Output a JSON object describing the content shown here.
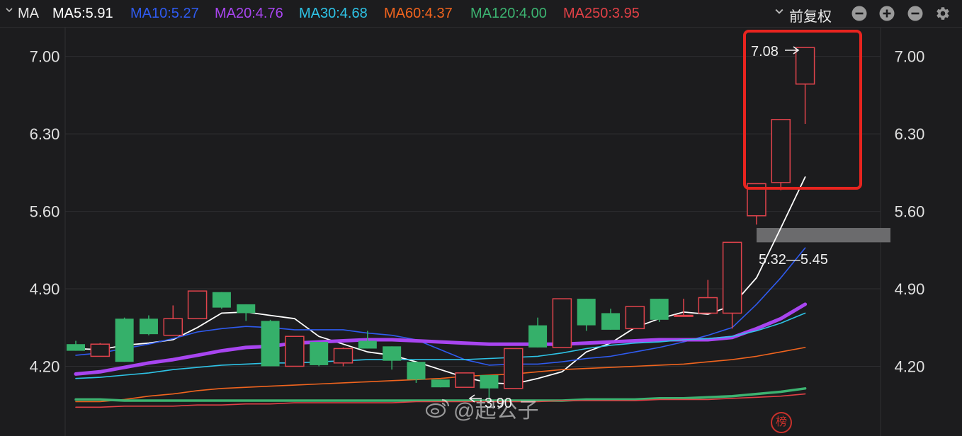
{
  "toolbar": {
    "title": "MA",
    "indicators": [
      {
        "label": "MA5:5.91",
        "color": "#ffffff"
      },
      {
        "label": "MA10:5.27",
        "color": "#2f5bf0"
      },
      {
        "label": "MA20:4.76",
        "color": "#a845f0"
      },
      {
        "label": "MA30:4.68",
        "color": "#2ec3e6"
      },
      {
        "label": "MA60:4.37",
        "color": "#f0641e"
      },
      {
        "label": "MA120:4.00",
        "color": "#3cb371"
      },
      {
        "label": "MA250:3.95",
        "color": "#e04046"
      }
    ],
    "adjust_label": "前复权",
    "icons": [
      "minus-circle-icon",
      "plus-circle-icon",
      "minus-circle-icon",
      "gear-icon"
    ]
  },
  "chart_data": {
    "type": "candlestick",
    "y_ticks": [
      "7.00",
      "6.30",
      "5.60",
      "4.90",
      "4.20"
    ],
    "ylim": [
      3.57,
      7.26
    ],
    "grid": true,
    "candles": [
      {
        "o": 4.4,
        "h": 4.43,
        "c": 4.34,
        "l": 4.34
      },
      {
        "o": 4.29,
        "h": 4.41,
        "c": 4.4,
        "l": 4.29
      },
      {
        "o": 4.63,
        "h": 4.64,
        "c": 4.24,
        "l": 4.24
      },
      {
        "o": 4.63,
        "h": 4.66,
        "c": 4.49,
        "l": 4.48
      },
      {
        "o": 4.48,
        "h": 4.75,
        "c": 4.63,
        "l": 4.48
      },
      {
        "o": 4.63,
        "h": 4.88,
        "c": 4.88,
        "l": 4.63
      },
      {
        "o": 4.87,
        "h": 4.87,
        "c": 4.73,
        "l": 4.72
      },
      {
        "o": 4.76,
        "h": 4.76,
        "c": 4.68,
        "l": 4.61
      },
      {
        "o": 4.61,
        "h": 4.62,
        "c": 4.2,
        "l": 4.2
      },
      {
        "o": 4.2,
        "h": 4.47,
        "c": 4.47,
        "l": 4.2
      },
      {
        "o": 4.42,
        "h": 4.42,
        "c": 4.21,
        "l": 4.2
      },
      {
        "o": 4.23,
        "h": 4.37,
        "c": 4.36,
        "l": 4.2
      },
      {
        "o": 4.43,
        "h": 4.52,
        "c": 4.36,
        "l": 4.36
      },
      {
        "o": 4.38,
        "h": 4.38,
        "c": 4.25,
        "l": 4.17
      },
      {
        "o": 4.24,
        "h": 4.24,
        "c": 4.08,
        "l": 4.05
      },
      {
        "o": 4.08,
        "h": 4.08,
        "c": 4.01,
        "l": 4.01
      },
      {
        "o": 4.01,
        "h": 4.14,
        "c": 4.14,
        "l": 4.01
      },
      {
        "o": 4.12,
        "h": 4.12,
        "c": 4.0,
        "l": 3.9
      },
      {
        "o": 4.0,
        "h": 4.36,
        "c": 4.36,
        "l": 4.0
      },
      {
        "o": 4.57,
        "h": 4.64,
        "c": 4.37,
        "l": 4.37
      },
      {
        "o": 4.37,
        "h": 4.81,
        "c": 4.81,
        "l": 4.37
      },
      {
        "o": 4.81,
        "h": 4.81,
        "c": 4.57,
        "l": 4.52
      },
      {
        "o": 4.68,
        "h": 4.72,
        "c": 4.53,
        "l": 4.53
      },
      {
        "o": 4.54,
        "h": 4.74,
        "c": 4.74,
        "l": 4.54
      },
      {
        "o": 4.81,
        "h": 4.81,
        "c": 4.62,
        "l": 4.6
      },
      {
        "o": 4.66,
        "h": 4.81,
        "c": 4.66,
        "l": 4.66
      },
      {
        "o": 4.68,
        "h": 4.98,
        "c": 4.82,
        "l": 4.68
      },
      {
        "o": 4.68,
        "h": 5.32,
        "c": 5.32,
        "l": 4.54
      },
      {
        "o": 5.56,
        "h": 5.85,
        "c": 5.85,
        "l": 5.48
      },
      {
        "o": 5.86,
        "h": 6.43,
        "c": 6.43,
        "l": 5.79
      },
      {
        "o": 6.75,
        "h": 7.08,
        "c": 7.08,
        "l": 6.39
      }
    ],
    "moving_averages": [
      {
        "name": "MA5",
        "color": "#ffffff",
        "width": 1.8,
        "values": [
          4.36,
          4.35,
          4.39,
          4.41,
          4.44,
          4.55,
          4.68,
          4.69,
          4.66,
          4.63,
          4.47,
          4.4,
          4.33,
          4.3,
          4.24,
          4.17,
          4.1,
          4.05,
          4.04,
          4.09,
          4.15,
          4.33,
          4.41,
          4.55,
          4.63,
          4.69,
          4.67,
          4.75,
          5.0,
          5.45,
          5.91
        ]
      },
      {
        "name": "MA10",
        "color": "#2f5bf0",
        "width": 1.6,
        "values": [
          4.3,
          4.32,
          4.36,
          4.4,
          4.45,
          4.51,
          4.54,
          4.56,
          4.55,
          4.53,
          4.53,
          4.53,
          4.5,
          4.48,
          4.44,
          4.35,
          4.26,
          4.21,
          4.22,
          4.22,
          4.24,
          4.27,
          4.29,
          4.33,
          4.37,
          4.42,
          4.48,
          4.55,
          4.76,
          5.0,
          5.27
        ]
      },
      {
        "name": "MA20",
        "color": "#a845f0",
        "width": 5,
        "values": [
          4.13,
          4.15,
          4.19,
          4.23,
          4.26,
          4.3,
          4.34,
          4.37,
          4.38,
          4.41,
          4.42,
          4.43,
          4.44,
          4.44,
          4.43,
          4.42,
          4.41,
          4.4,
          4.4,
          4.4,
          4.4,
          4.41,
          4.42,
          4.43,
          4.44,
          4.44,
          4.44,
          4.46,
          4.54,
          4.63,
          4.76
        ]
      },
      {
        "name": "MA30",
        "color": "#2ec3e6",
        "width": 1.6,
        "values": [
          4.09,
          4.1,
          4.12,
          4.14,
          4.17,
          4.19,
          4.21,
          4.22,
          4.23,
          4.23,
          4.24,
          4.25,
          4.26,
          4.26,
          4.26,
          4.26,
          4.26,
          4.27,
          4.28,
          4.29,
          4.32,
          4.36,
          4.39,
          4.41,
          4.42,
          4.44,
          4.45,
          4.47,
          4.52,
          4.59,
          4.68
        ]
      },
      {
        "name": "MA60",
        "color": "#f0641e",
        "width": 1.6,
        "values": [
          3.88,
          3.88,
          3.9,
          3.93,
          3.95,
          3.98,
          4.0,
          4.01,
          4.02,
          4.03,
          4.04,
          4.05,
          4.06,
          4.07,
          4.08,
          4.09,
          4.11,
          4.12,
          4.13,
          4.15,
          4.17,
          4.18,
          4.19,
          4.2,
          4.21,
          4.22,
          4.24,
          4.26,
          4.29,
          4.33,
          4.37
        ]
      },
      {
        "name": "MA120",
        "color": "#3cb371",
        "width": 3.5,
        "values": [
          3.9,
          3.9,
          3.89,
          3.89,
          3.89,
          3.89,
          3.89,
          3.89,
          3.89,
          3.89,
          3.89,
          3.89,
          3.89,
          3.89,
          3.89,
          3.89,
          3.89,
          3.89,
          3.89,
          3.89,
          3.89,
          3.9,
          3.9,
          3.9,
          3.91,
          3.91,
          3.92,
          3.93,
          3.95,
          3.97,
          4.0
        ]
      },
      {
        "name": "MA250",
        "color": "#e04046",
        "width": 1.6,
        "values": [
          3.83,
          3.83,
          3.84,
          3.84,
          3.84,
          3.85,
          3.85,
          3.86,
          3.86,
          3.87,
          3.87,
          3.87,
          3.87,
          3.87,
          3.88,
          3.88,
          3.88,
          3.88,
          3.88,
          3.88,
          3.89,
          3.89,
          3.89,
          3.89,
          3.9,
          3.9,
          3.9,
          3.91,
          3.92,
          3.93,
          3.95
        ]
      }
    ],
    "annotations": {
      "high_label": "7.08",
      "low_label": "3.90",
      "gap_label": "5.32—5.45",
      "gap_range": [
        5.32,
        5.45
      ]
    },
    "up_color": "#e0434c",
    "down_color": "#35b06a"
  },
  "watermark": {
    "text": "@起公子"
  },
  "badge": {
    "text": "榜"
  }
}
